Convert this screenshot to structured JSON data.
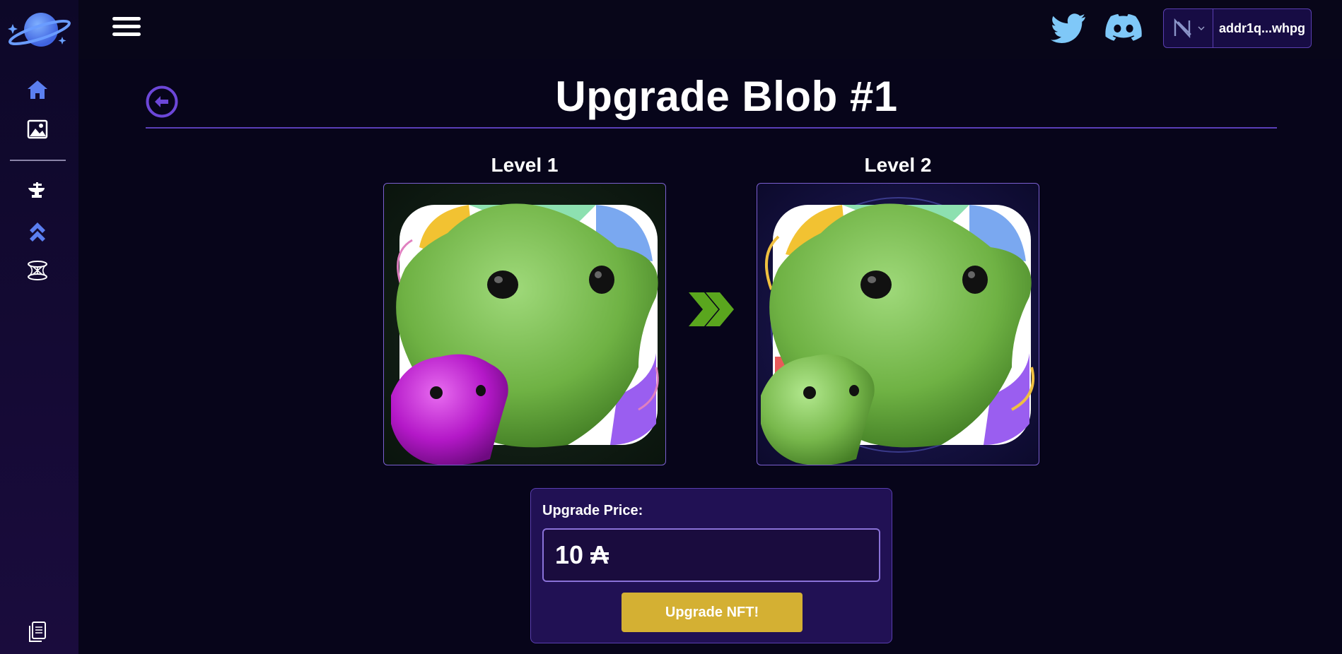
{
  "page": {
    "title": "Upgrade Blob #1"
  },
  "wallet": {
    "address": "addr1q...whpg"
  },
  "levels": {
    "current_label": "Level 1",
    "next_label": "Level 2"
  },
  "price": {
    "label": "Upgrade Price:",
    "value": "10 ₳"
  },
  "actions": {
    "upgrade_label": "Upgrade NFT!"
  },
  "colors": {
    "accent": "#6c47d8",
    "button": "#d4b033",
    "arrow": "#5aa61e",
    "sidebar_icon": "#5b7ff0"
  },
  "icons": {
    "sidebar": [
      "home-icon",
      "gallery-icon",
      "forge-icon",
      "upgrade-icon",
      "portal-icon",
      "docs-icon"
    ],
    "social": [
      "twitter-icon",
      "discord-icon"
    ]
  }
}
